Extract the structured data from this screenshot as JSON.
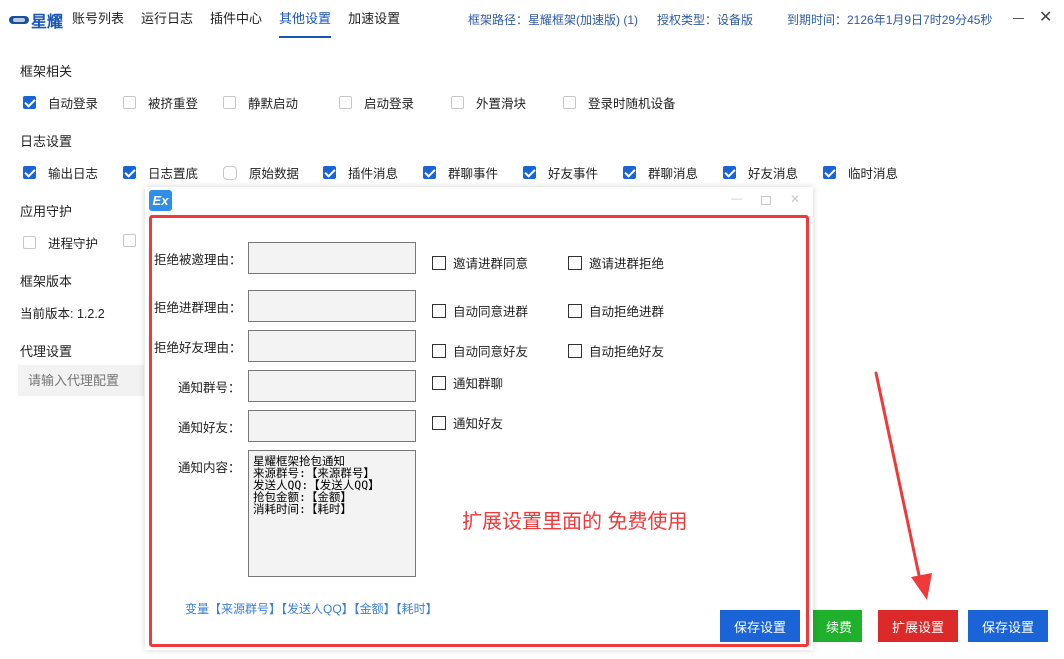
{
  "logo": {
    "mark_text": "星耀"
  },
  "nav": [
    {
      "label": "账号列表",
      "active": false
    },
    {
      "label": "运行日志",
      "active": false
    },
    {
      "label": "插件中心",
      "active": false
    },
    {
      "label": "其他设置",
      "active": true
    },
    {
      "label": "加速设置",
      "active": false
    }
  ],
  "info": {
    "frame_path": "框架路径：星耀框架(加速版) (1)",
    "auth_type": "授权类型：设备版",
    "expire": "到期时间：2126年1月9日7时29分45秒"
  },
  "window": {
    "minimize": "—",
    "close": "✕"
  },
  "frame_section": {
    "title": "框架相关",
    "items": [
      {
        "label": "自动登录",
        "checked": true
      },
      {
        "label": "被挤重登",
        "checked": false
      },
      {
        "label": "静默启动",
        "checked": false
      },
      {
        "label": "启动登录",
        "checked": false
      },
      {
        "label": "外置滑块",
        "checked": false
      },
      {
        "label": "登录时随机设备",
        "checked": false
      }
    ]
  },
  "log_section": {
    "title": "日志设置",
    "items": [
      {
        "label": "输出日志",
        "checked": true
      },
      {
        "label": "日志置底",
        "checked": true
      },
      {
        "label": "原始数据",
        "checked": false
      },
      {
        "label": "插件消息",
        "checked": true
      },
      {
        "label": "群聊事件",
        "checked": true
      },
      {
        "label": "好友事件",
        "checked": true
      },
      {
        "label": "群聊消息",
        "checked": true
      },
      {
        "label": "好友消息",
        "checked": true
      },
      {
        "label": "临时消息",
        "checked": true
      }
    ]
  },
  "guard_section": {
    "title": "应用守护",
    "items": [
      {
        "label": "进程守护",
        "checked": false
      }
    ]
  },
  "version_section": {
    "title": "框架版本",
    "current": "当前版本: 1.2.2"
  },
  "proxy_section": {
    "title": "代理设置",
    "placeholder": "请输入代理配置"
  },
  "bottom_buttons": {
    "renew": "续费",
    "extend": "扩展设置",
    "save": "保存设置"
  },
  "colors": {
    "primary": "#1a64d8",
    "danger": "#dc2a2a",
    "success": "#1fb02c",
    "highlight": "#ee3a3a"
  },
  "dialog": {
    "icon": "Ex",
    "fields": [
      {
        "label": "拒绝被邀理由："
      },
      {
        "label": "拒绝进群理由："
      },
      {
        "label": "拒绝好友理由："
      },
      {
        "label": "通知群号："
      },
      {
        "label": "通知好友："
      }
    ],
    "content_label": "通知内容：",
    "content_value": "星耀框架抢包通知\n来源群号:【来源群号】\n发送人QQ:【发送人QQ】\n抢包金额:【金额】\n消耗时间:【耗时】",
    "checkboxes": [
      {
        "label": "邀请进群同意",
        "checked": false
      },
      {
        "label": "邀请进群拒绝",
        "checked": false
      },
      {
        "label": "自动同意进群",
        "checked": false
      },
      {
        "label": "自动拒绝进群",
        "checked": false
      },
      {
        "label": "自动同意好友",
        "checked": false
      },
      {
        "label": "自动拒绝好友",
        "checked": false
      },
      {
        "label": "通知群聊",
        "checked": false
      },
      {
        "label": "通知好友",
        "checked": false
      }
    ],
    "variables": "变量【来源群号】【发送人QQ】【金额】【耗时】",
    "save": "保存设置",
    "annotation": "扩展设置里面的 免费使用"
  }
}
